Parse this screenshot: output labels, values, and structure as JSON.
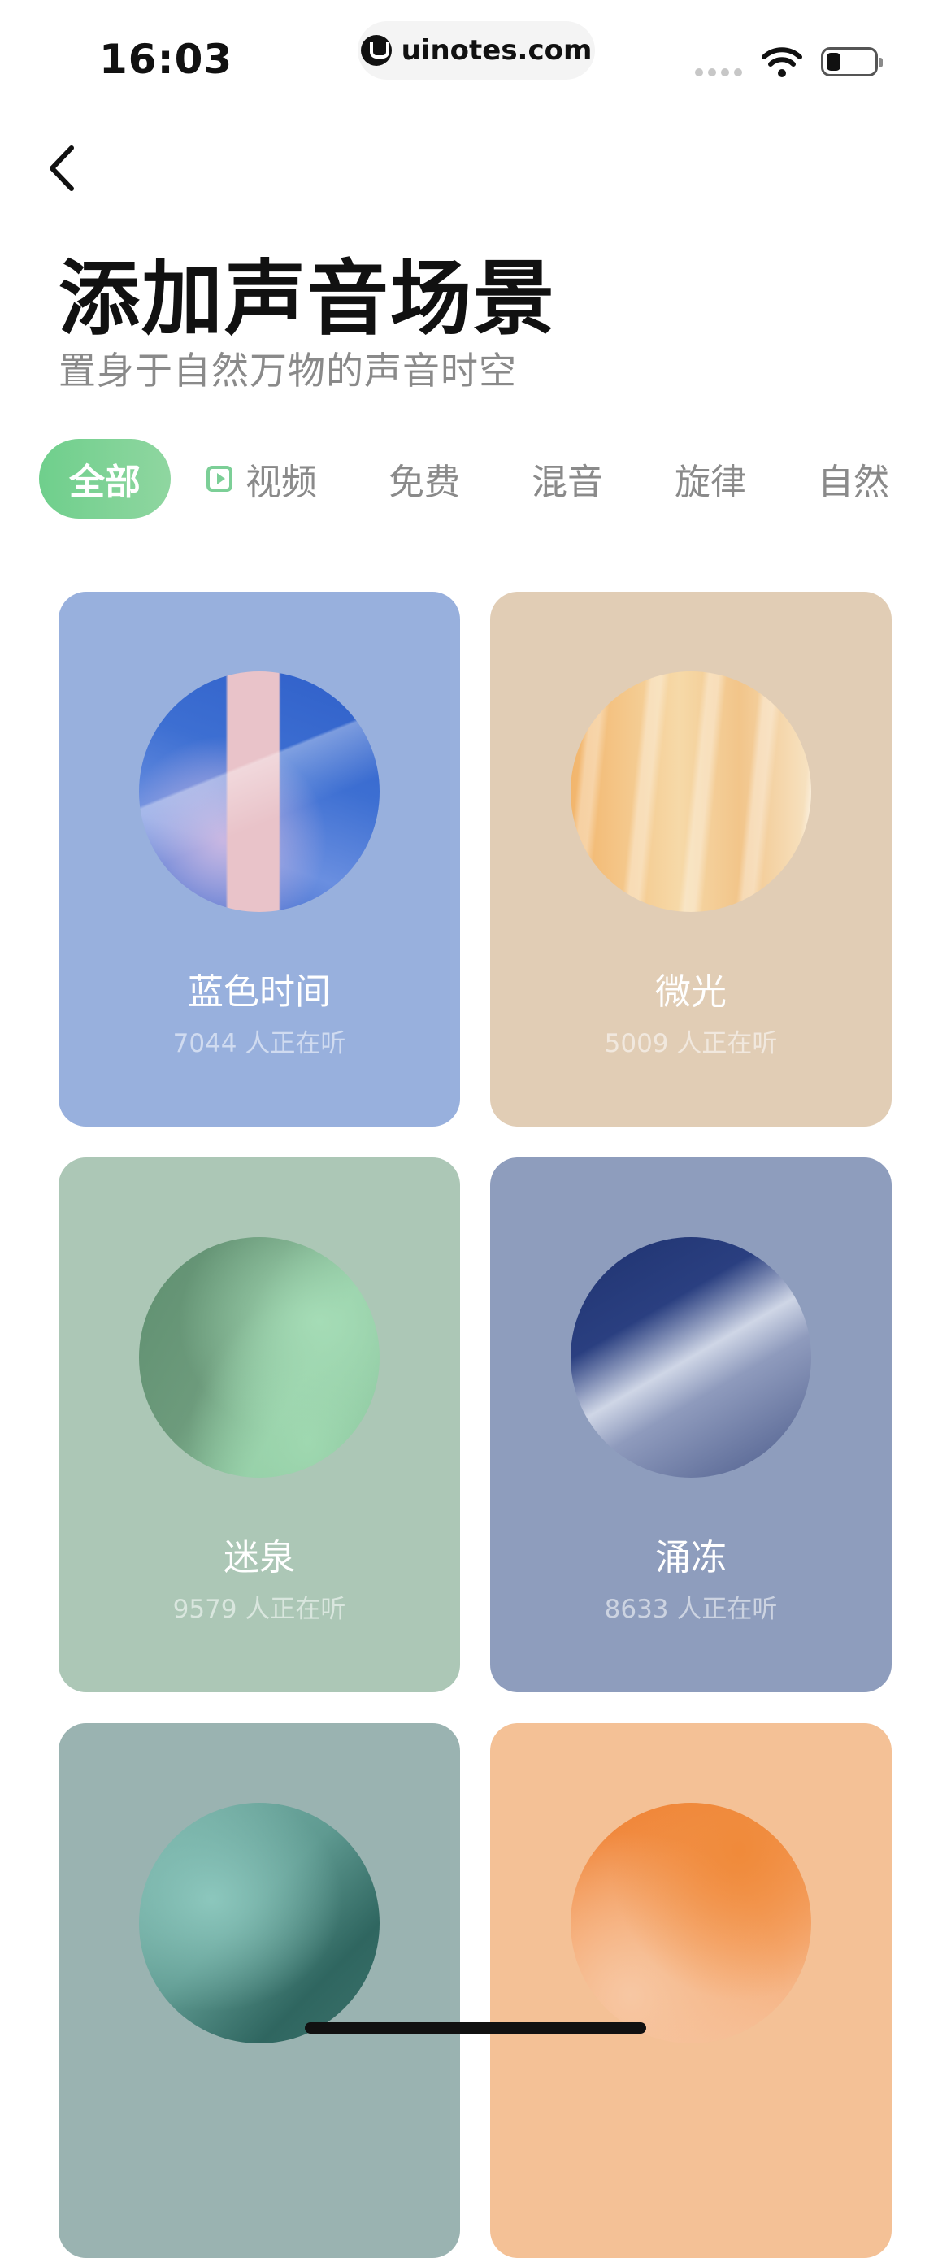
{
  "status_bar": {
    "time": "16:03",
    "url": "uinotes.com"
  },
  "header": {
    "title": "添加声音场景",
    "subtitle": "置身于自然万物的声音时空"
  },
  "tabs": [
    {
      "label": "全部",
      "active": true
    },
    {
      "label": "视频",
      "icon": "video-play-icon"
    },
    {
      "label": "免费"
    },
    {
      "label": "混音"
    },
    {
      "label": "旋律"
    },
    {
      "label": "自然"
    }
  ],
  "cards": [
    {
      "name": "蓝色时间",
      "listeners": "7044 人正在听",
      "color": "#98b0dd"
    },
    {
      "name": "微光",
      "listeners": "5009 人正在听",
      "color": "#e1cdb5"
    },
    {
      "name": "迷泉",
      "listeners": "9579 人正在听",
      "color": "#acc7b6"
    },
    {
      "name": "涌冻",
      "listeners": "8633 人正在听",
      "color": "#8e9dbd"
    },
    {
      "color": "#9ab3b1"
    },
    {
      "color": "#f4c196"
    }
  ]
}
